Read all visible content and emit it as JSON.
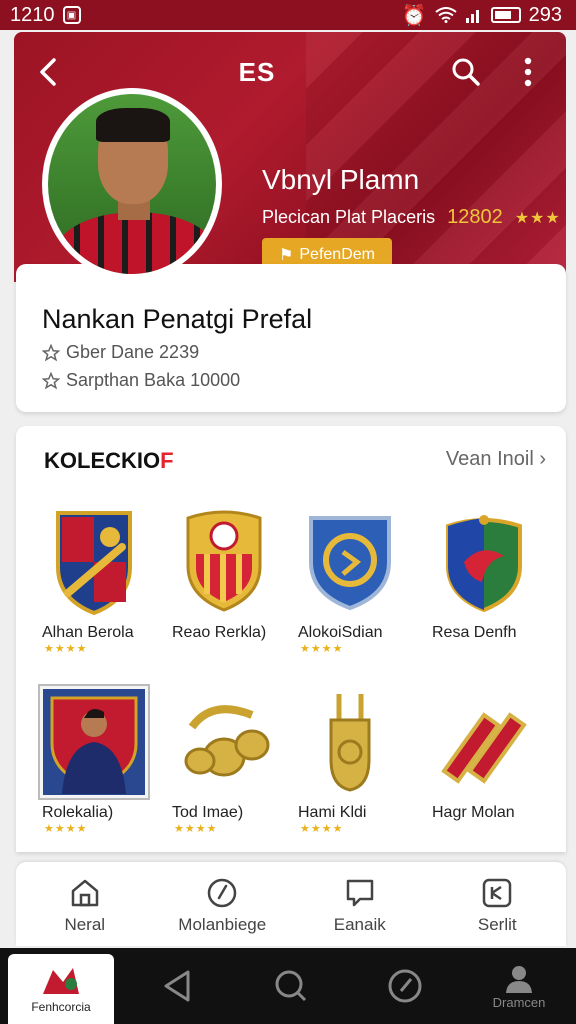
{
  "status_bar": {
    "time": "1210",
    "right_text": "293"
  },
  "header": {
    "title": "ES",
    "player_name": "Vbnyl Plamn",
    "subtitle": "Plecican Plat Placeris",
    "score": "12802",
    "rating_suffix": "★★★",
    "follow_label": "PefenDem"
  },
  "profile_card": {
    "title": "Nankan Penatgi Prefal",
    "line1": "Gber Dane 2239",
    "line2": "Sarpthan Baka 10000"
  },
  "collection": {
    "title_main": "KOLECKIO",
    "title_accent": "F",
    "view_all": "Vean Inoil",
    "items": [
      {
        "label": "Alhan Berola",
        "stars": "★★★★"
      },
      {
        "label": "Reao Rerkla)",
        "stars": ""
      },
      {
        "label": "AlokoiSdian",
        "stars": "★★★★"
      },
      {
        "label": "Resa Denfh",
        "stars": ""
      },
      {
        "label": "Rolekalia)",
        "stars": "★★★★"
      },
      {
        "label": "Tod Imae)",
        "stars": "★★★★"
      },
      {
        "label": "Hami Kldi",
        "stars": "★★★★"
      },
      {
        "label": "Hagr Molan",
        "stars": ""
      }
    ]
  },
  "app_nav": [
    {
      "label": "Neral",
      "icon": "home-icon"
    },
    {
      "label": "Molanbiege",
      "icon": "clock-icon"
    },
    {
      "label": "Eanaik",
      "icon": "chat-icon"
    },
    {
      "label": "Serlit",
      "icon": "shield-icon"
    }
  ],
  "system_nav": {
    "app_label": "Fenhcorcia",
    "profile_label": "Dramcen"
  },
  "colors": {
    "brand_red": "#9c1424",
    "gold": "#e6a824",
    "accent_red": "#e5232f"
  }
}
